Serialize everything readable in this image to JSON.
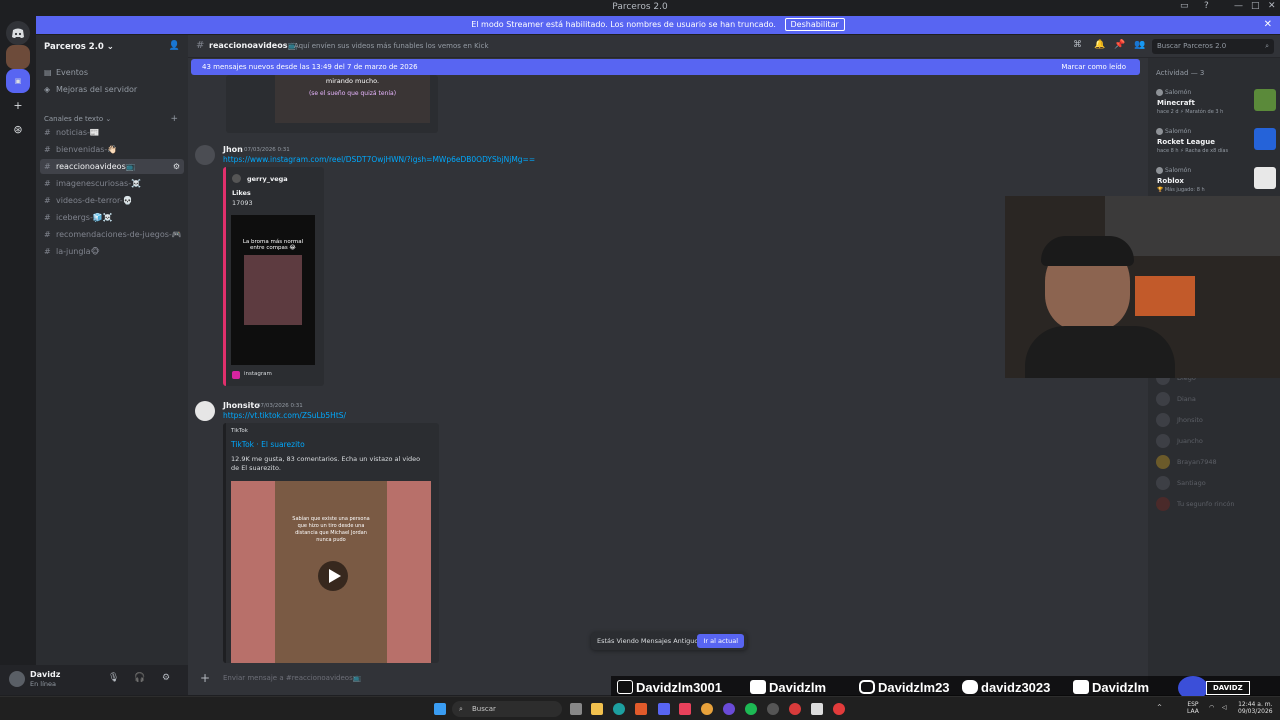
{
  "window": {
    "title": "Parceros 2.0"
  },
  "banner": {
    "text": "El modo Streamer está habilitado. Los nombres de usuario se han truncado.",
    "button": "Deshabilitar"
  },
  "server": {
    "name": "Parceros 2.0"
  },
  "sidebar": {
    "top_items": [
      {
        "label": "Eventos",
        "icon": "calendar-icon"
      },
      {
        "label": "Mejoras del servidor",
        "icon": "boost-icon"
      }
    ],
    "category": "Canales de texto",
    "channels": [
      {
        "label": "noticias-📰",
        "selected": false
      },
      {
        "label": "bienvenidas-👋🏻",
        "selected": false
      },
      {
        "label": "reaccionoavideos📺",
        "selected": true
      },
      {
        "label": "imagenescuriosas-☠️",
        "selected": false
      },
      {
        "label": "videos-de-terror-💀",
        "selected": false
      },
      {
        "label": "icebergs-🧊☠️",
        "selected": false
      },
      {
        "label": "recomendaciones-de-juegos-🎮",
        "selected": false
      },
      {
        "label": "la-jungla🐵",
        "selected": false
      }
    ]
  },
  "user": {
    "name": "Davidz",
    "status": "En línea"
  },
  "channel_header": {
    "name": "reaccionoavideos📺",
    "topic": "Aquí envíen sus videos más funables los vemos en Kick",
    "search_placeholder": "Buscar Parceros 2.0"
  },
  "new_messages": {
    "text": "43 mensajes nuevos desde las 13:49 del 7 de marzo de 2026",
    "mark_read": "Marcar como leído"
  },
  "messages": [
    {
      "author": "Jhon",
      "time": "07/03/2026 0:31",
      "link": "https://www.instagram.com/reel/DSDT7OwjHWN/?igsh=MWp6eDB0ODYSbjNjMg==",
      "embed": {
        "account": "gerry_vega",
        "likes_label": "Likes",
        "likes": "17093",
        "video_caption": "La broma más normal entre compas 😂",
        "footer": "instagram",
        "accent": "#e1306c"
      }
    },
    {
      "author": "Jhonsito",
      "time": "07/03/2026 0:31",
      "link": "https://vt.tiktok.com/ZSuLb5HtS/",
      "embed": {
        "provider": "TikTok",
        "title": "TikTok · El suarezito",
        "description": "12.9K me gusta, 83 comentarios. Echa un vistazo al video de El suarezito.",
        "video_caption": "Sabían que existe una persona que hizo un tiro desde una distancia que Michael Jordan nunca pudo"
      }
    }
  ],
  "prev_embed_caption": "(se el sueño que quizá tenía)",
  "prev_embed_top_text": "mirando mucho.",
  "jump_bar": {
    "text": "Estás Viendo Mensajes Antiguos",
    "button": "Ir al actual"
  },
  "composer": {
    "placeholder": "Enviar mensaje a #reaccionoavideos📺"
  },
  "members": {
    "header": "Actividad — 3",
    "activities": [
      {
        "user": "Salomón",
        "game": "Minecraft",
        "meta": "hace 2 d   ⚡ Maratón de 3 h"
      },
      {
        "user": "Salomón",
        "game": "Rocket League",
        "meta": "hace 8 h   ⚡ Racha de x8 días"
      },
      {
        "user": "Salomón",
        "game": "Roblox",
        "meta": "🏆 Más jugado: 8 h"
      }
    ],
    "offline": [
      "Diego",
      "Diana",
      "Jhonsito",
      "Juancho",
      "Brayan7948",
      "Santiago",
      "Tu segunfo rincón"
    ]
  },
  "socials": [
    {
      "icon": "tiktok-icon",
      "handle": "Davidzlm3001"
    },
    {
      "icon": "youtube-icon",
      "handle": "Davidzlm"
    },
    {
      "icon": "instagram-icon",
      "handle": "Davidzlm23"
    },
    {
      "icon": "discord-icon",
      "handle": "davidz3023"
    },
    {
      "icon": "kick-icon",
      "handle": "Davidzlm"
    }
  ],
  "overlay_badge": "DAVIDZ",
  "taskbar": {
    "search": "Buscar",
    "lang": "ESP",
    "region": "LAA",
    "time": "12:44 a. m.",
    "date": "09/03/2026"
  },
  "colors": {
    "accent": "#5865f2",
    "link": "#00a8fc",
    "bg": "#313338"
  }
}
